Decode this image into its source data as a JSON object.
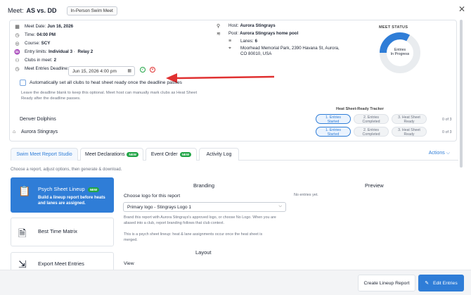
{
  "header": {
    "meet_prefix": "Meet:",
    "meet_name": "AS vs. DD",
    "meet_type": "In-Person Swim Meet",
    "close_icon": "close-icon"
  },
  "details": {
    "date_label": "Meet Date:",
    "date_value": "Jun 16, 2026",
    "time_label": "Time:",
    "time_value": "04:00 PM",
    "course_label": "Course:",
    "course_value": "SCY",
    "limits_label": "Entry limits:",
    "limits_individual": "Individual 3",
    "limits_relay": "Relay 2",
    "clubs_label": "Clubs in meet:",
    "clubs_value": "2",
    "deadline_label": "Meet Entries Deadline:",
    "deadline_value": "Jun 15, 2026 4:00 pm"
  },
  "host": {
    "host_label": "Host:",
    "host_value": "Aurora Stingrays",
    "pool_label": "Pool:",
    "pool_value": "Aurora Stingrays home pool",
    "lanes_label": "Lanes:",
    "lanes_value": "6",
    "address_line1": "Moorhead Memorial Park, 2390 Havana St, Aurora,",
    "address_line2": "CO 80010, USA"
  },
  "auto_ready": {
    "label": "Automatically set all clubs to heat sheet ready once the deadline passes",
    "help_line1": "Leave the deadline blank to keep this optional. Meet host can manually mark clubs as Heat Sheet",
    "help_line2": "Ready after the deadline passes.",
    "checked": false
  },
  "status": {
    "title": "MEET STATUS",
    "label_line1": "Entries",
    "label_line2": "In Progress",
    "progress_fraction": 0.33,
    "color_active": "#2f7dd7",
    "color_track": "#e9ecef"
  },
  "tracker": {
    "title": "Heat Sheet-Ready Tracker",
    "clubs": [
      {
        "name": "Dolphins",
        "prefix": "Denver",
        "count": "0 of 3",
        "steps": [
          {
            "l1": "1. Entries",
            "l2": "Started"
          },
          {
            "l1": "2. Entries",
            "l2": "Completed"
          },
          {
            "l1": "3. Heat Sheet",
            "l2": "Ready"
          }
        ]
      },
      {
        "name": "Aurora Stingrays",
        "count": "0 of 3",
        "steps": [
          {
            "l1": "1. Entries",
            "l2": "Started"
          },
          {
            "l1": "2. Entries",
            "l2": "Completed"
          },
          {
            "l1": "3. Heat Sheet",
            "l2": "Ready"
          }
        ]
      }
    ]
  },
  "tabs": {
    "items": [
      {
        "label": "Swim Meet Report Studio",
        "new": ""
      },
      {
        "label": "Meet Declarations",
        "new": "NEW"
      },
      {
        "label": "Event Order",
        "new": "NEW"
      },
      {
        "label": "Activity Log",
        "new": ""
      }
    ],
    "actions": "Actions"
  },
  "studio": {
    "help": "Choose a report, adjust options, then generate & download.",
    "reports": [
      {
        "title": "Psych Sheet Lineup",
        "badge": "NEW",
        "desc": "Build a lineup report before heats and lanes are assigned."
      },
      {
        "title": "Best Time Matrix"
      },
      {
        "title": "Export Meet Entries"
      }
    ],
    "branding_title": "Branding",
    "logo_label": "Choose logo for this report",
    "logo_value": "Primary logo - Stingrays Logo 1",
    "brand_help1": "Brand this report with Aurora Stingrays's approved logo, or choose No Logo. When you are",
    "brand_help2": "aliased into a club, report branding follows that club context.",
    "psych_note1": "This is a psych sheet lineup: heat & lane assignments occur once the heat sheet is",
    "psych_note2": "merged.",
    "layout_title": "Layout",
    "view_label": "View",
    "preview_title": "Preview",
    "preview_empty": "No entries yet."
  },
  "footer": {
    "create_label": "Create Lineup Report",
    "edit_label": "Edit Entries"
  }
}
